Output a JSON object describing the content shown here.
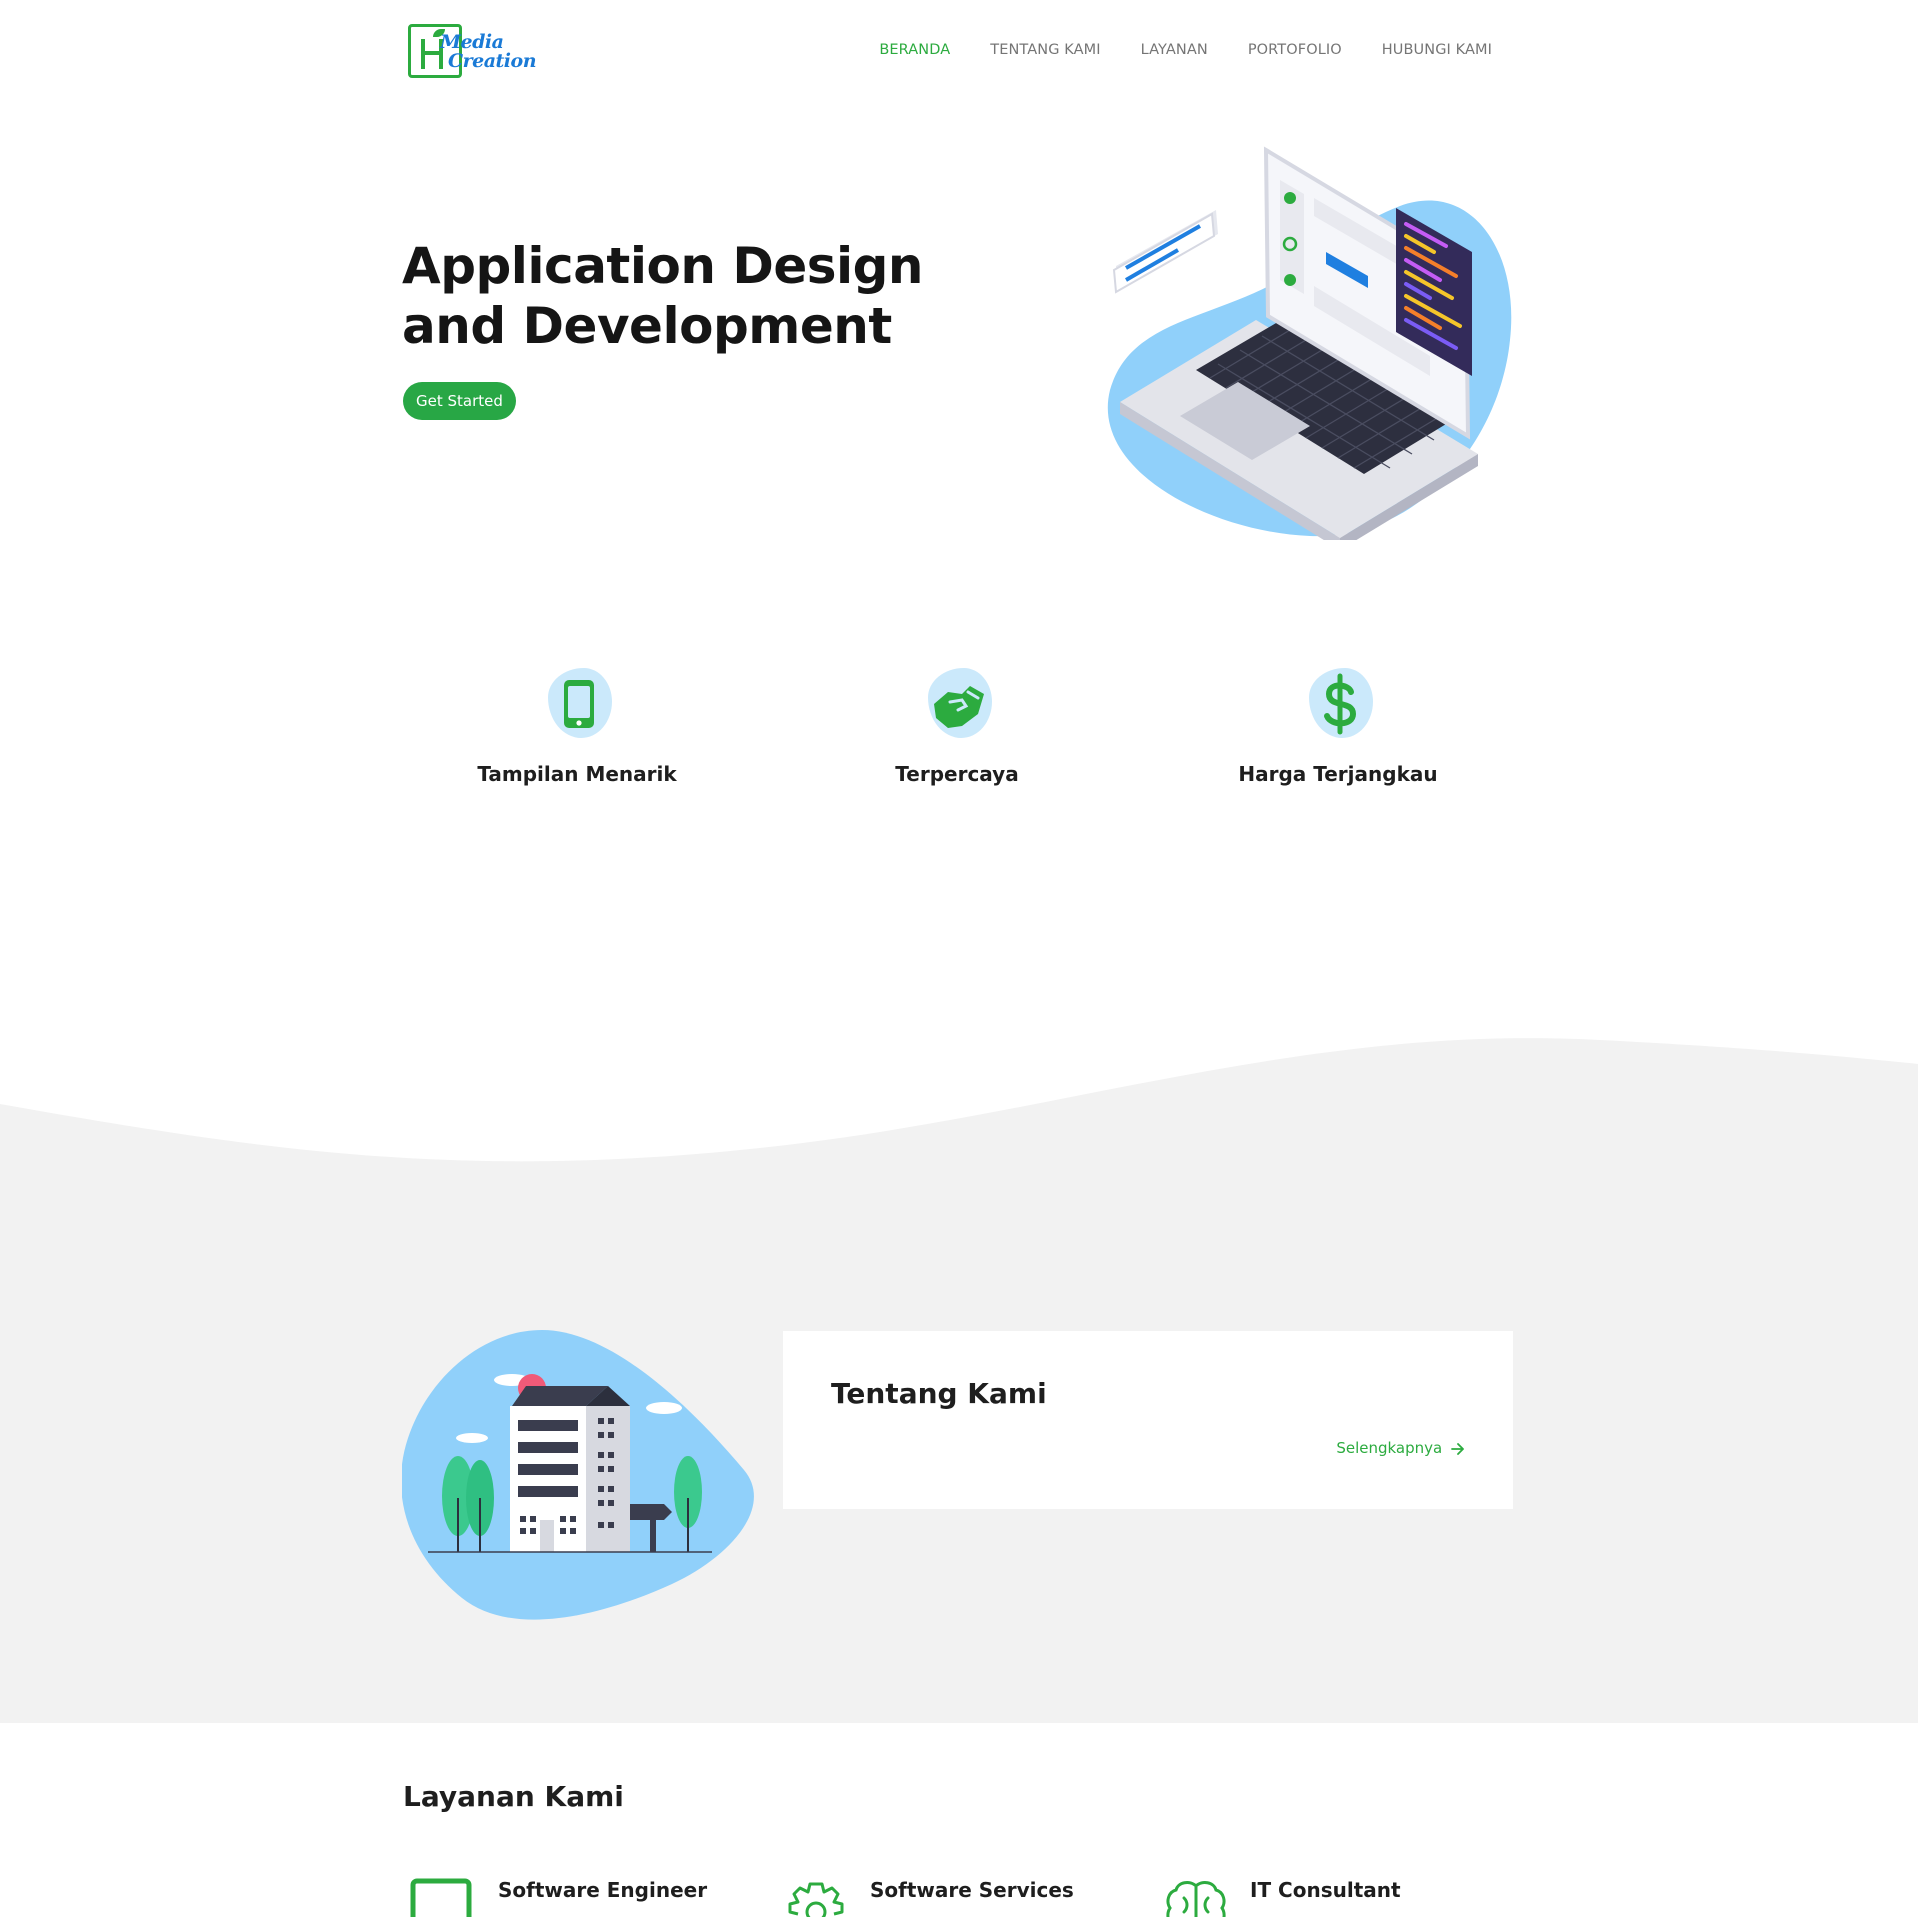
{
  "brand": {
    "line1": "Media",
    "line2": "Creation",
    "color": "#1a7ad6",
    "accent": "#2cab3f"
  },
  "nav": {
    "items": [
      {
        "label": "BERANDA",
        "active": true
      },
      {
        "label": "TENTANG KAMI",
        "active": false
      },
      {
        "label": "LAYANAN",
        "active": false
      },
      {
        "label": "PORTOFOLIO",
        "active": false
      },
      {
        "label": "HUBUNGI KAMI",
        "active": false
      }
    ]
  },
  "hero": {
    "title_line1": "Application Design",
    "title_line2": "and Development",
    "cta_label": "Get Started",
    "illustration": "laptop-code-illustration"
  },
  "features": [
    {
      "title": "Tampilan Menarik",
      "icon": "mobile-phone-icon"
    },
    {
      "title": "Terpercaya",
      "icon": "handshake-icon"
    },
    {
      "title": "Harga Terjangkau",
      "icon": "dollar-icon"
    }
  ],
  "about": {
    "title": "Tentang Kami",
    "more_label": "Selengkapnya",
    "illustration": "office-building-illustration"
  },
  "services": {
    "title": "Layanan Kami",
    "items": [
      {
        "name": "Software Engineer",
        "icon": "laptop-icon"
      },
      {
        "name": "Software Services",
        "icon": "gear-icon"
      },
      {
        "name": "IT Consultant",
        "icon": "brain-icon"
      }
    ]
  },
  "colors": {
    "primary_green": "#28a745",
    "blob_blue": "#90d0fa",
    "section_gray": "#f2f2f2"
  }
}
